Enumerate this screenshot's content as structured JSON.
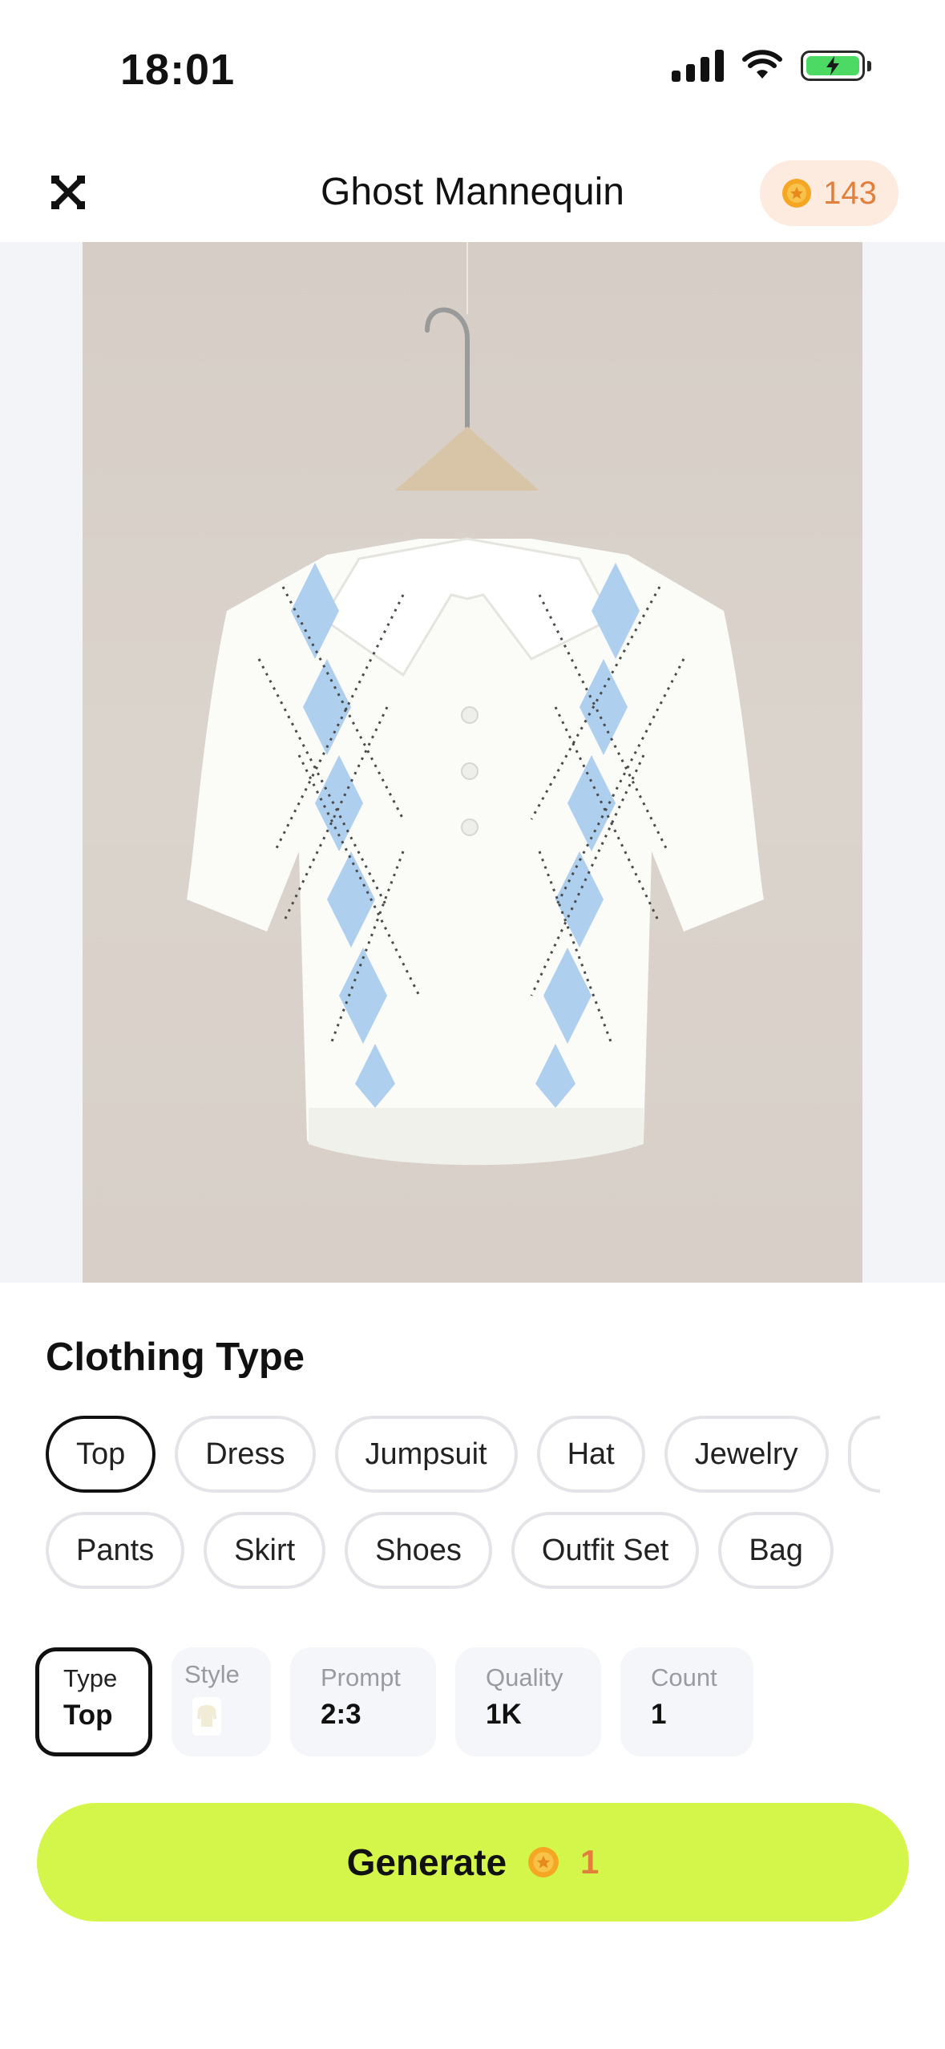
{
  "status": {
    "time": "18:01"
  },
  "header": {
    "title": "Ghost Mannequin",
    "coins": "143"
  },
  "clothing": {
    "section_title": "Clothing Type",
    "row1": [
      "Top",
      "Dress",
      "Jumpsuit",
      "Hat",
      "Jewelry"
    ],
    "row2": [
      "Pants",
      "Skirt",
      "Shoes",
      "Outfit Set",
      "Bag"
    ],
    "selected": "Top"
  },
  "settings": {
    "type": {
      "label": "Type",
      "value": "Top"
    },
    "style": {
      "label": "Style"
    },
    "prompt": {
      "label": "Prompt",
      "value": "2:3"
    },
    "quality": {
      "label": "Quality",
      "value": "1K"
    },
    "count": {
      "label": "Count",
      "value": "1"
    }
  },
  "generate": {
    "label": "Generate",
    "cost": "1"
  },
  "colors": {
    "accent": "#d4f54a",
    "coin": "#e27f3b",
    "coin_bg": "#fdebe0"
  }
}
